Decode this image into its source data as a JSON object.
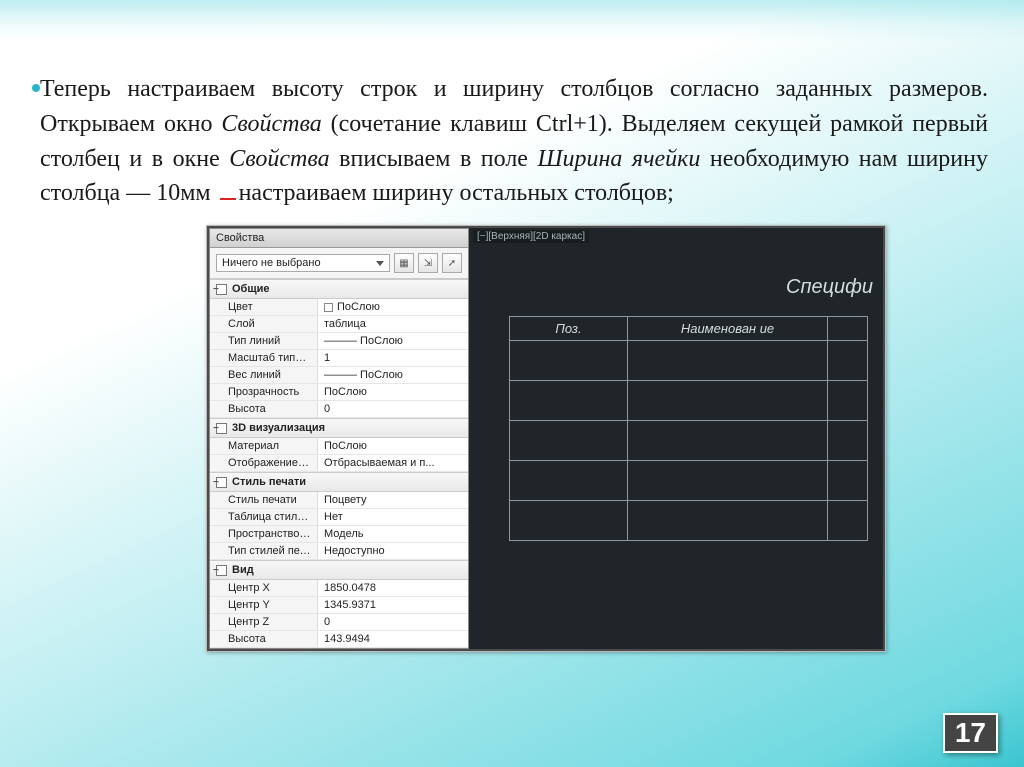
{
  "slide": {
    "paragraph": {
      "t1": "Теперь настраиваем высоту строк и ширину столбцов согласно заданных размеров. Открываем окно ",
      "i1": "Свойства",
      "t2": " (сочетание клавиш Ctrl+1). Выделяем секущей рамкой первый столбец и в окне ",
      "i2": "Свойства",
      "t3": " вписываем в поле ",
      "i3": "Ширина ячейки",
      "t4": " необходимую нам ширину столбца — 10мм ",
      "t5": "настраиваем ширину остальных столбцов;"
    }
  },
  "props_panel": {
    "title": "Свойства",
    "selector": "Ничего не выбрано",
    "sections": {
      "general": {
        "head": "Общие",
        "rows": [
          {
            "k": "Цвет",
            "v": "ПоСлою",
            "sq": true
          },
          {
            "k": "Слой",
            "v": "таблица"
          },
          {
            "k": "Тип линий",
            "v": "——— ПоСлою"
          },
          {
            "k": "Масштаб типа ...",
            "v": "1"
          },
          {
            "k": "Вес линий",
            "v": "——— ПоСлою"
          },
          {
            "k": "Прозрачность",
            "v": "ПоСлою"
          },
          {
            "k": "Высота",
            "v": "0"
          }
        ]
      },
      "viz3d": {
        "head": "3D визуализация",
        "rows": [
          {
            "k": "Материал",
            "v": "ПоСлою"
          },
          {
            "k": "Отображение т...",
            "v": "Отбрасываемая и п..."
          }
        ]
      },
      "plot": {
        "head": "Стиль печати",
        "rows": [
          {
            "k": "Стиль печати",
            "v": "Поцвету"
          },
          {
            "k": "Таблица стиле...",
            "v": "Нет"
          },
          {
            "k": "Пространство т...",
            "v": "Модель"
          },
          {
            "k": "Тип стилей печ...",
            "v": "Недоступно"
          }
        ]
      },
      "view": {
        "head": "Вид",
        "rows": [
          {
            "k": "Центр X",
            "v": "1850.0478"
          },
          {
            "k": "Центр Y",
            "v": "1345.9371"
          },
          {
            "k": "Центр Z",
            "v": "0"
          },
          {
            "k": "Высота",
            "v": "143.9494"
          }
        ]
      }
    }
  },
  "drawing": {
    "view_tab": "[−][Верхняя][2D каркас]",
    "spec_title": "Специфи",
    "headers": [
      "Поз.",
      "Наименован\nие"
    ]
  },
  "pageno": "17"
}
